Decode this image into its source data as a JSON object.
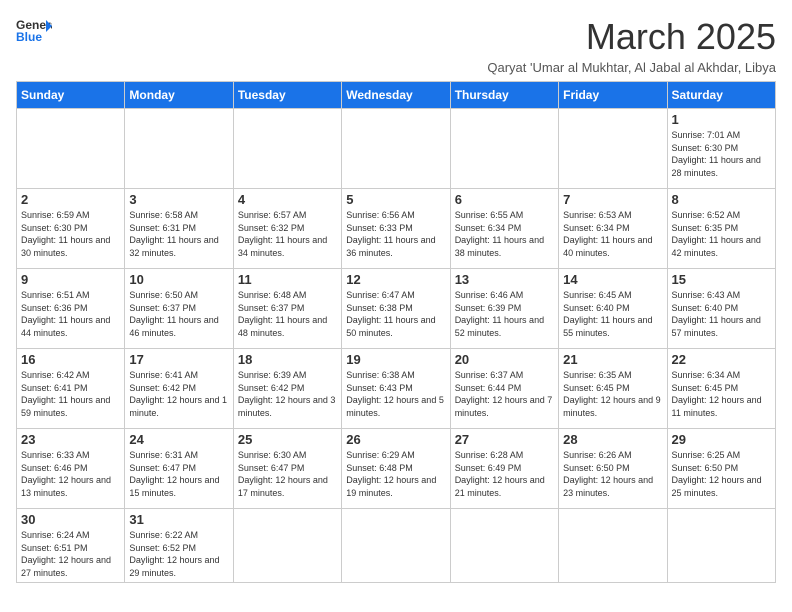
{
  "header": {
    "logo_general": "General",
    "logo_blue": "Blue",
    "month_title": "March 2025",
    "subtitle": "Qaryat 'Umar al Mukhtar, Al Jabal al Akhdar, Libya"
  },
  "weekdays": [
    "Sunday",
    "Monday",
    "Tuesday",
    "Wednesday",
    "Thursday",
    "Friday",
    "Saturday"
  ],
  "weeks": [
    [
      {
        "day": "",
        "info": ""
      },
      {
        "day": "",
        "info": ""
      },
      {
        "day": "",
        "info": ""
      },
      {
        "day": "",
        "info": ""
      },
      {
        "day": "",
        "info": ""
      },
      {
        "day": "",
        "info": ""
      },
      {
        "day": "1",
        "info": "Sunrise: 7:01 AM\nSunset: 6:30 PM\nDaylight: 11 hours\nand 28 minutes."
      }
    ],
    [
      {
        "day": "2",
        "info": "Sunrise: 6:59 AM\nSunset: 6:30 PM\nDaylight: 11 hours\nand 30 minutes."
      },
      {
        "day": "3",
        "info": "Sunrise: 6:58 AM\nSunset: 6:31 PM\nDaylight: 11 hours\nand 32 minutes."
      },
      {
        "day": "4",
        "info": "Sunrise: 6:57 AM\nSunset: 6:32 PM\nDaylight: 11 hours\nand 34 minutes."
      },
      {
        "day": "5",
        "info": "Sunrise: 6:56 AM\nSunset: 6:33 PM\nDaylight: 11 hours\nand 36 minutes."
      },
      {
        "day": "6",
        "info": "Sunrise: 6:55 AM\nSunset: 6:34 PM\nDaylight: 11 hours\nand 38 minutes."
      },
      {
        "day": "7",
        "info": "Sunrise: 6:53 AM\nSunset: 6:34 PM\nDaylight: 11 hours\nand 40 minutes."
      },
      {
        "day": "8",
        "info": "Sunrise: 6:52 AM\nSunset: 6:35 PM\nDaylight: 11 hours\nand 42 minutes."
      }
    ],
    [
      {
        "day": "9",
        "info": "Sunrise: 6:51 AM\nSunset: 6:36 PM\nDaylight: 11 hours\nand 44 minutes."
      },
      {
        "day": "10",
        "info": "Sunrise: 6:50 AM\nSunset: 6:37 PM\nDaylight: 11 hours\nand 46 minutes."
      },
      {
        "day": "11",
        "info": "Sunrise: 6:48 AM\nSunset: 6:37 PM\nDaylight: 11 hours\nand 48 minutes."
      },
      {
        "day": "12",
        "info": "Sunrise: 6:47 AM\nSunset: 6:38 PM\nDaylight: 11 hours\nand 50 minutes."
      },
      {
        "day": "13",
        "info": "Sunrise: 6:46 AM\nSunset: 6:39 PM\nDaylight: 11 hours\nand 52 minutes."
      },
      {
        "day": "14",
        "info": "Sunrise: 6:45 AM\nSunset: 6:40 PM\nDaylight: 11 hours\nand 55 minutes."
      },
      {
        "day": "15",
        "info": "Sunrise: 6:43 AM\nSunset: 6:40 PM\nDaylight: 11 hours\nand 57 minutes."
      }
    ],
    [
      {
        "day": "16",
        "info": "Sunrise: 6:42 AM\nSunset: 6:41 PM\nDaylight: 11 hours\nand 59 minutes."
      },
      {
        "day": "17",
        "info": "Sunrise: 6:41 AM\nSunset: 6:42 PM\nDaylight: 12 hours\nand 1 minute."
      },
      {
        "day": "18",
        "info": "Sunrise: 6:39 AM\nSunset: 6:42 PM\nDaylight: 12 hours\nand 3 minutes."
      },
      {
        "day": "19",
        "info": "Sunrise: 6:38 AM\nSunset: 6:43 PM\nDaylight: 12 hours\nand 5 minutes."
      },
      {
        "day": "20",
        "info": "Sunrise: 6:37 AM\nSunset: 6:44 PM\nDaylight: 12 hours\nand 7 minutes."
      },
      {
        "day": "21",
        "info": "Sunrise: 6:35 AM\nSunset: 6:45 PM\nDaylight: 12 hours\nand 9 minutes."
      },
      {
        "day": "22",
        "info": "Sunrise: 6:34 AM\nSunset: 6:45 PM\nDaylight: 12 hours\nand 11 minutes."
      }
    ],
    [
      {
        "day": "23",
        "info": "Sunrise: 6:33 AM\nSunset: 6:46 PM\nDaylight: 12 hours\nand 13 minutes."
      },
      {
        "day": "24",
        "info": "Sunrise: 6:31 AM\nSunset: 6:47 PM\nDaylight: 12 hours\nand 15 minutes."
      },
      {
        "day": "25",
        "info": "Sunrise: 6:30 AM\nSunset: 6:47 PM\nDaylight: 12 hours\nand 17 minutes."
      },
      {
        "day": "26",
        "info": "Sunrise: 6:29 AM\nSunset: 6:48 PM\nDaylight: 12 hours\nand 19 minutes."
      },
      {
        "day": "27",
        "info": "Sunrise: 6:28 AM\nSunset: 6:49 PM\nDaylight: 12 hours\nand 21 minutes."
      },
      {
        "day": "28",
        "info": "Sunrise: 6:26 AM\nSunset: 6:50 PM\nDaylight: 12 hours\nand 23 minutes."
      },
      {
        "day": "29",
        "info": "Sunrise: 6:25 AM\nSunset: 6:50 PM\nDaylight: 12 hours\nand 25 minutes."
      }
    ],
    [
      {
        "day": "30",
        "info": "Sunrise: 6:24 AM\nSunset: 6:51 PM\nDaylight: 12 hours\nand 27 minutes."
      },
      {
        "day": "31",
        "info": "Sunrise: 6:22 AM\nSunset: 6:52 PM\nDaylight: 12 hours\nand 29 minutes."
      },
      {
        "day": "",
        "info": ""
      },
      {
        "day": "",
        "info": ""
      },
      {
        "day": "",
        "info": ""
      },
      {
        "day": "",
        "info": ""
      },
      {
        "day": "",
        "info": ""
      }
    ]
  ]
}
